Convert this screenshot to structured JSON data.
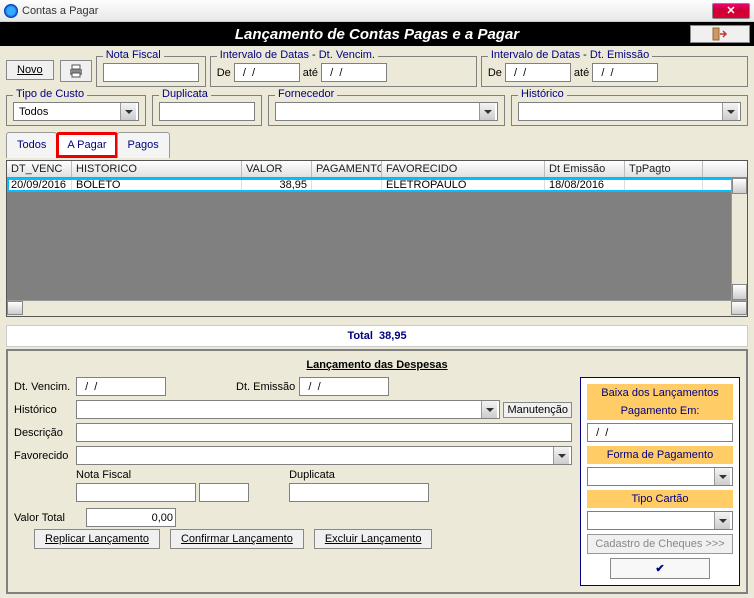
{
  "window": {
    "title": "Contas a Pagar"
  },
  "banner": {
    "title": "Lançamento de Contas Pagas e a Pagar"
  },
  "buttons": {
    "novo": "Novo",
    "replicar": "Replicar Lançamento",
    "confirmar": "Confirmar Lançamento",
    "excluir": "Excluir Lançamento",
    "manutencao": "Manutenção",
    "cadastro_cheques": "Cadastro de Cheques  >>>",
    "ok": "✔"
  },
  "fieldsets": {
    "nota_fiscal": "Nota Fiscal",
    "intervalo_venc": "Intervalo de Datas - Dt. Vencim.",
    "intervalo_emis": "Intervalo de Datas - Dt. Emissão",
    "tipo_custo": "Tipo de Custo",
    "duplicata": "Duplicata",
    "fornecedor": "Fornecedor",
    "historico": "Histórico",
    "de": "De",
    "ate": "até"
  },
  "filters": {
    "nota_fiscal": "",
    "venc_de": "  /  /    ",
    "venc_ate": "  /  /    ",
    "emis_de": "  /  /    ",
    "emis_ate": "  /  /    ",
    "tipo_custo": "Todos",
    "duplicata": "",
    "fornecedor": "",
    "historico": ""
  },
  "tabs": {
    "todos": "Todos",
    "apagar": "A Pagar",
    "pagos": "Pagos"
  },
  "grid": {
    "headers": {
      "dt_venc": "DT_VENC",
      "historico": "HISTORICO",
      "valor": "VALOR",
      "pagamento": "PAGAMENTO",
      "favorecido": "FAVORECIDO",
      "dt_emissao": "Dt Emissão",
      "tp_pagto": "TpPagto"
    },
    "rows": [
      {
        "dt_venc": "20/09/2016",
        "historico": "BOLETO",
        "valor": "38,95",
        "pagamento": "",
        "favorecido": "ELETROPAULO",
        "dt_emissao": "18/08/2016",
        "tp_pagto": ""
      }
    ]
  },
  "total": {
    "label": "Total",
    "value": "38,95"
  },
  "launch": {
    "title": "Lançamento das Despesas",
    "labels": {
      "dt_vencim": "Dt. Vencim.",
      "dt_emissao": "Dt. Emissão",
      "historico": "Histórico",
      "descricao": "Descrição",
      "favorecido": "Favorecido",
      "nota_fiscal": "Nota Fiscal",
      "duplicata": "Duplicata",
      "valor_total": "Valor Total"
    },
    "values": {
      "dt_vencim": "  /  /    ",
      "dt_emissao": "  /  /    ",
      "historico": "",
      "descricao": "",
      "favorecido": "",
      "nota_fiscal": "",
      "nota_fiscal2": "",
      "duplicata": "",
      "valor_total": "0,00"
    }
  },
  "payment": {
    "baixa_title1": "Baixa dos Lançamentos",
    "baixa_title2": "Pagamento  Em:",
    "data": "  /  /",
    "forma_label": "Forma de Pagamento",
    "forma": "",
    "tipo_cartao_label": "Tipo Cartão",
    "tipo_cartao": ""
  }
}
